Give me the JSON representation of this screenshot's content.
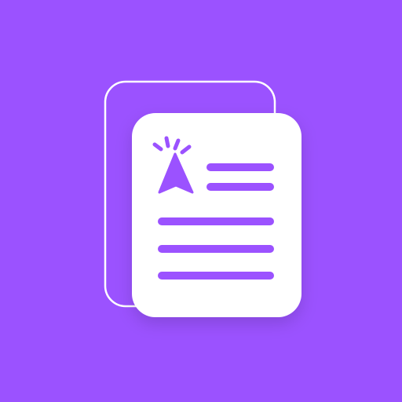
{
  "icon": {
    "name": "document-click-icon",
    "colors": {
      "background": "#9B52FF",
      "page": "#FFFFFF",
      "accent": "#9B52FF",
      "outline": "#FFFFFF"
    }
  }
}
